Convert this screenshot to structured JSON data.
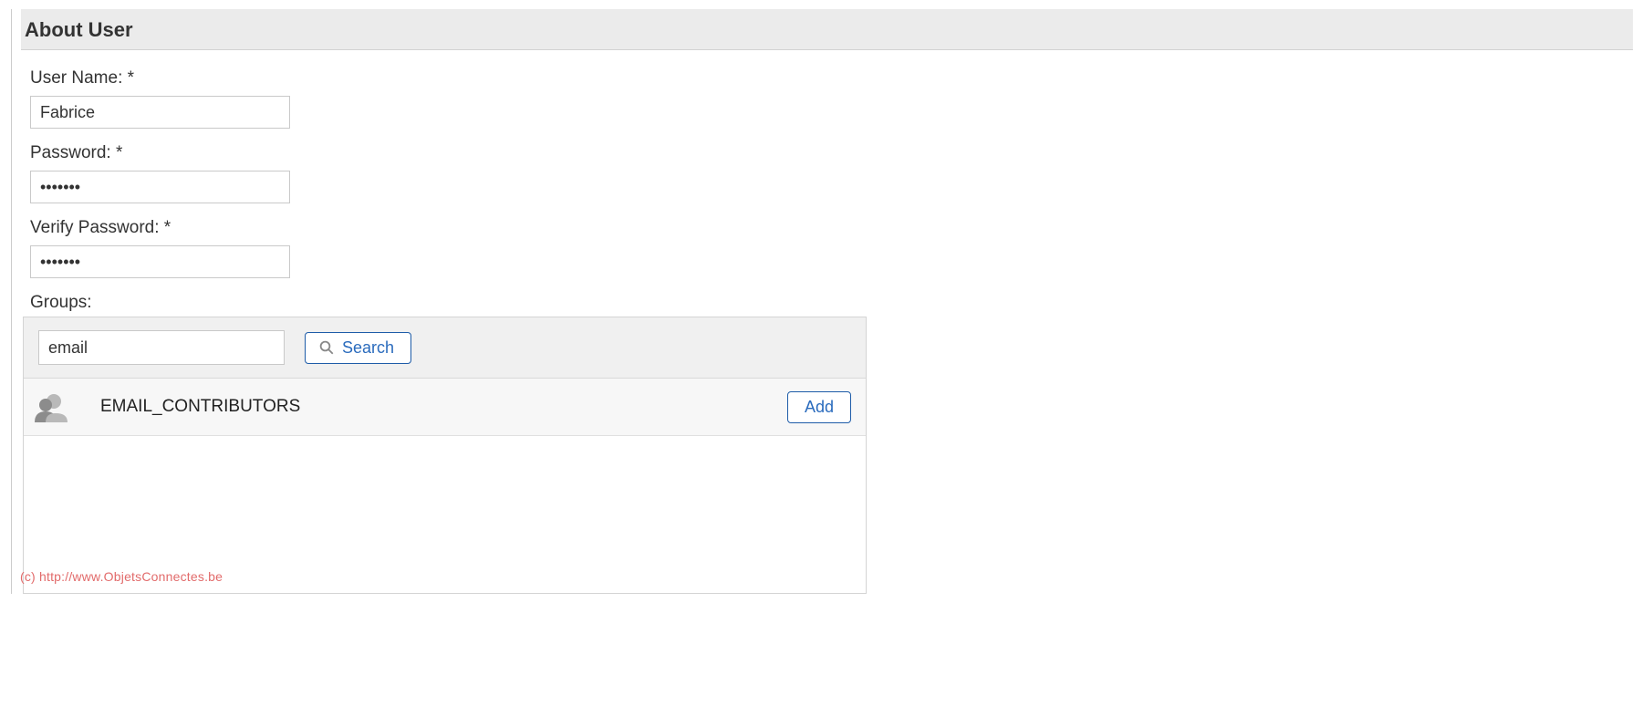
{
  "section": {
    "title": "About User"
  },
  "fields": {
    "username_label": "User Name: *",
    "username_value": "Fabrice",
    "password_label": "Password: *",
    "password_value": "•••••••",
    "verify_label": "Verify Password: *",
    "verify_value": "•••••••",
    "groups_label": "Groups:"
  },
  "search": {
    "value": "email",
    "button_label": "Search"
  },
  "results": [
    {
      "name": "EMAIL_CONTRIBUTORS",
      "add_label": "Add"
    }
  ],
  "watermark": "(c) http://www.ObjetsConnectes.be"
}
